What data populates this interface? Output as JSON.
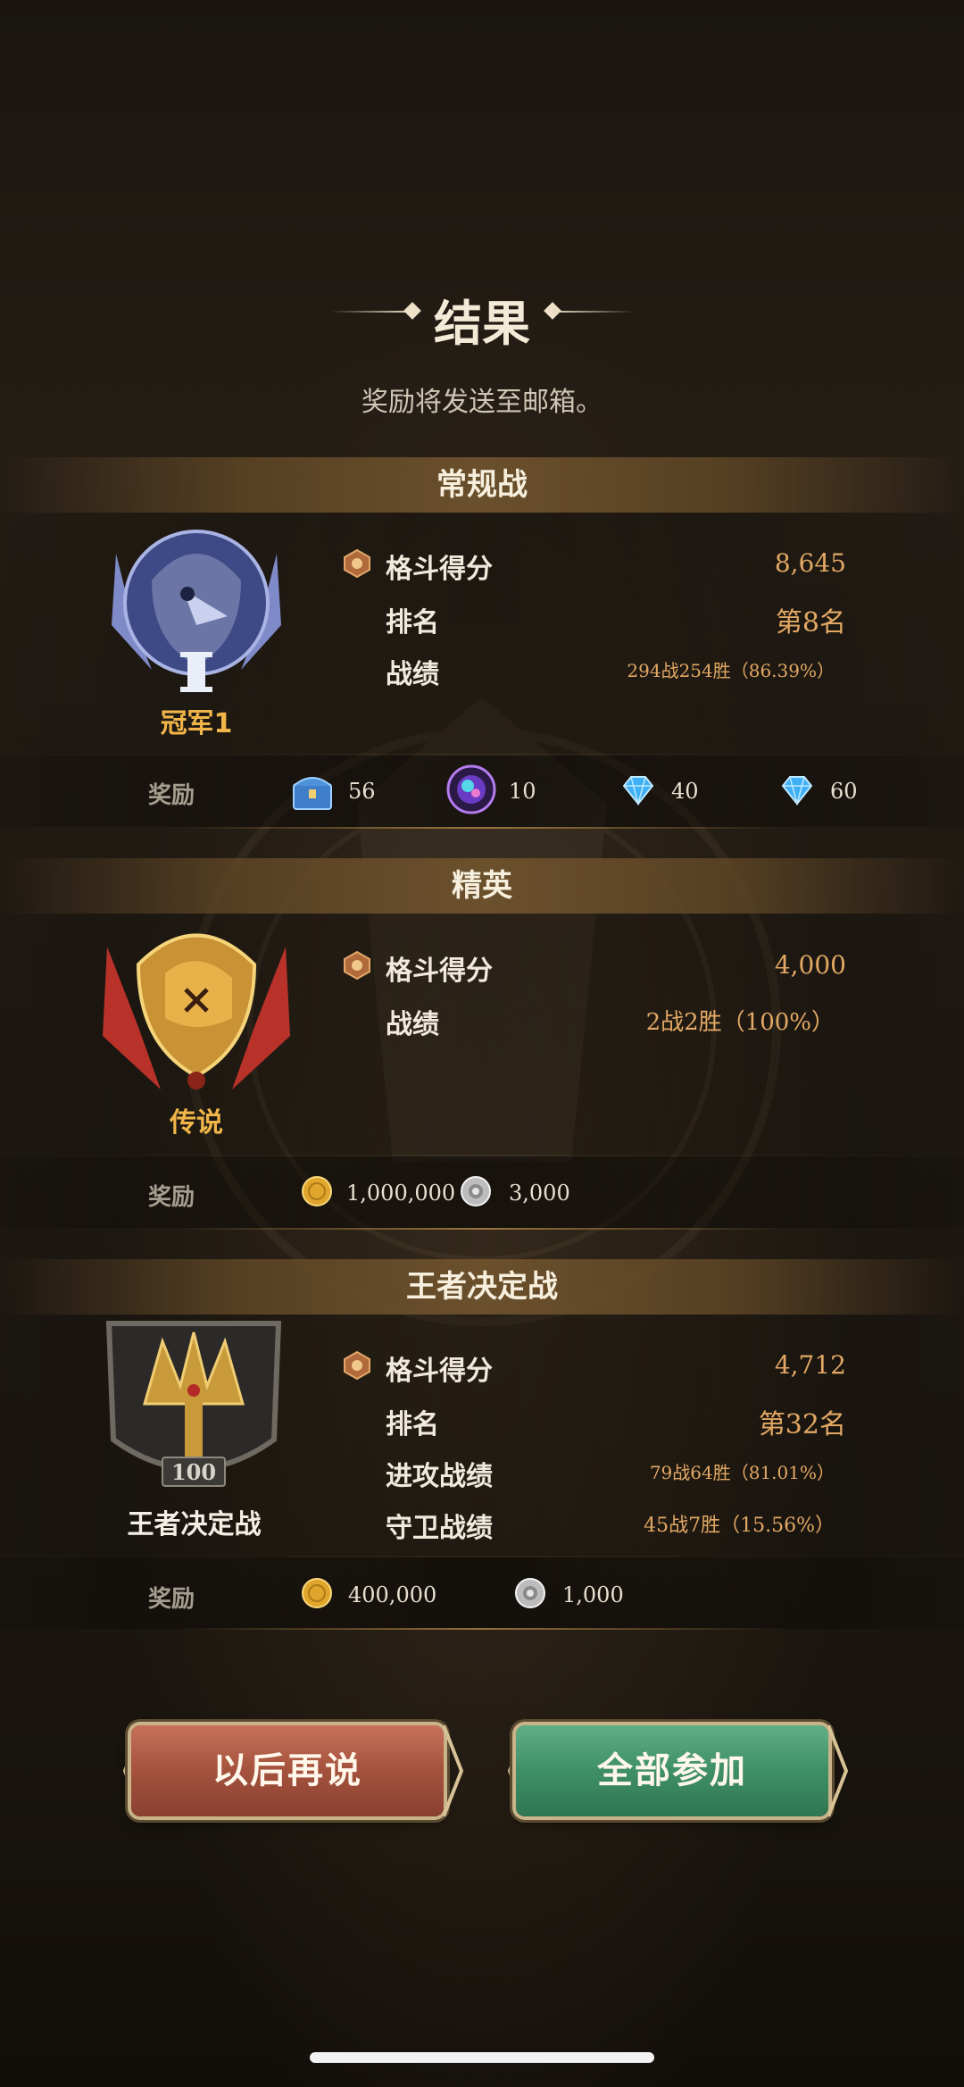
{
  "header": {
    "title": "结果",
    "subtitle": "奖励将发送至邮箱。"
  },
  "sections": [
    {
      "title": "常规战",
      "badge": {
        "label": "冠军1",
        "label_color": "#f0b548",
        "roman": "I"
      },
      "stats": [
        {
          "label": "格斗得分",
          "value": "8,645"
        },
        {
          "label": "排名",
          "value": "第8名"
        },
        {
          "label": "战绩",
          "value": "294战254胜（86.39%）"
        }
      ],
      "reward_label": "奖励",
      "rewards": [
        {
          "icon": "treasure-chest-icon",
          "value": "56"
        },
        {
          "icon": "purple-orb-icon",
          "value": "10"
        },
        {
          "icon": "blue-diamond-icon",
          "value": "40"
        },
        {
          "icon": "blue-diamond-icon",
          "value": "60"
        }
      ]
    },
    {
      "title": "精英",
      "badge": {
        "label": "传说",
        "label_color": "#f0b548"
      },
      "stats": [
        {
          "label": "格斗得分",
          "value": "4,000"
        },
        {
          "label": "战绩",
          "value": "2战2胜（100%）"
        }
      ],
      "reward_label": "奖励",
      "rewards": [
        {
          "icon": "gold-coin-icon",
          "value": "1,000,000"
        },
        {
          "icon": "silver-medal-icon",
          "value": "3,000"
        }
      ]
    },
    {
      "title": "王者决定战",
      "badge": {
        "label": "王者决定战",
        "label_color": "#f4efe6",
        "number": "100"
      },
      "stats": [
        {
          "label": "格斗得分",
          "value": "4,712"
        },
        {
          "label": "排名",
          "value": "第32名"
        },
        {
          "label": "进攻战绩",
          "value": "79战64胜（81.01%）"
        },
        {
          "label": "守卫战绩",
          "value": "45战7胜（15.56%）"
        }
      ],
      "reward_label": "奖励",
      "rewards": [
        {
          "icon": "gold-coin-icon",
          "value": "400,000"
        },
        {
          "icon": "silver-medal-icon",
          "value": "1,000"
        }
      ]
    }
  ],
  "buttons": {
    "later": "以后再说",
    "join": "全部参加"
  }
}
